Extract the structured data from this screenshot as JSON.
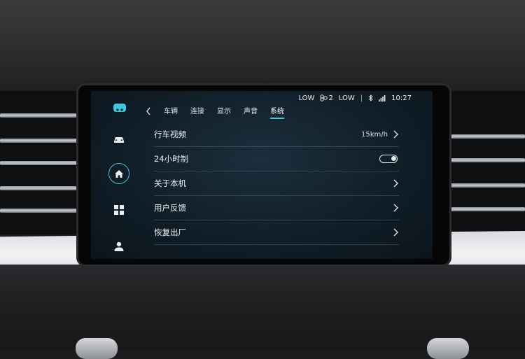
{
  "status": {
    "ac_left": "LOW",
    "fan_level": "2",
    "ac_right": "LOW",
    "separator": "|",
    "time": "10:27"
  },
  "tabs": [
    {
      "label": "车辆",
      "active": false
    },
    {
      "label": "连接",
      "active": false
    },
    {
      "label": "显示",
      "active": false
    },
    {
      "label": "声音",
      "active": false
    },
    {
      "label": "系统",
      "active": true
    }
  ],
  "sidebar": {
    "items": [
      {
        "icon": "car-icon"
      },
      {
        "icon": "home-icon",
        "active": true
      },
      {
        "icon": "apps-grid-icon"
      },
      {
        "icon": "user-icon"
      }
    ]
  },
  "settings": [
    {
      "label": "行车视频",
      "value": "15km/h",
      "control": "chevron"
    },
    {
      "label": "24小时制",
      "control": "toggle",
      "state": "on"
    },
    {
      "label": "关于本机",
      "control": "chevron"
    },
    {
      "label": "用户反馈",
      "control": "chevron"
    },
    {
      "label": "恢复出厂",
      "control": "chevron"
    }
  ],
  "colors": {
    "accent": "#3bc7e0",
    "screen_bg": "#101d27"
  }
}
